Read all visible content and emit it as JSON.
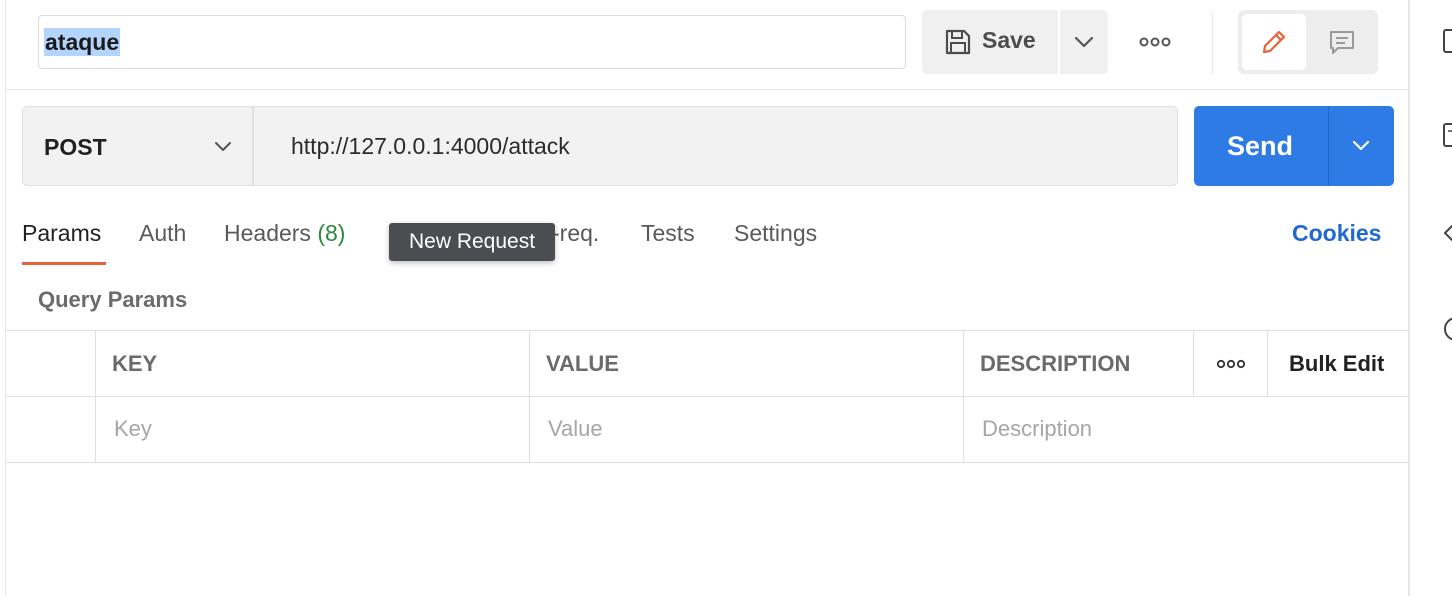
{
  "request": {
    "name": "ataque",
    "save_label": "Save",
    "method": "POST",
    "url": "http://127.0.0.1:4000/attack",
    "send_label": "Send"
  },
  "tabs": [
    {
      "label": "Params",
      "active": true
    },
    {
      "label": "Auth"
    },
    {
      "label": "Headers",
      "count": "(8)"
    },
    {
      "label": "-req."
    },
    {
      "label": "Tests"
    },
    {
      "label": "Settings"
    }
  ],
  "cookies_label": "Cookies",
  "tooltip": "New Request",
  "query_params": {
    "title": "Query Params",
    "headers": {
      "key": "KEY",
      "value": "VALUE",
      "description": "DESCRIPTION",
      "bulk_edit": "Bulk Edit"
    },
    "placeholders": {
      "key": "Key",
      "value": "Value",
      "description": "Description"
    }
  },
  "colors": {
    "accent_send": "#2e7be6",
    "tab_active_underline": "#e8623a",
    "headers_count": "#2b8a3e",
    "cookies_link": "#2268d1",
    "edit_icon": "#e8623a"
  },
  "icons": [
    "save-icon",
    "chevron-down-icon",
    "more-horizontal-icon",
    "pencil-icon",
    "comment-icon"
  ]
}
